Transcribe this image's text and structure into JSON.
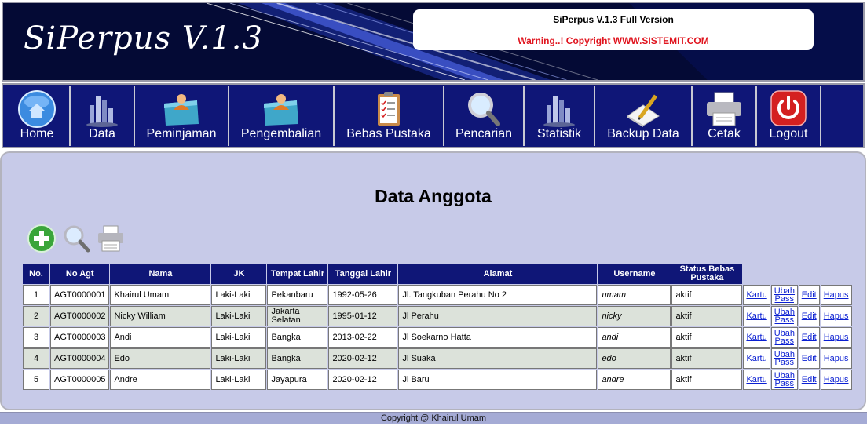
{
  "header": {
    "logo_text": "SiPerpus V.1.3",
    "info_title": "SiPerpus V.1.3 Full Version",
    "info_warning": "Warning..! Copyright WWW.SISTEMIT.COM"
  },
  "nav": {
    "items": [
      {
        "label": "Home",
        "icon": "home-icon"
      },
      {
        "label": "Data",
        "icon": "bar-chart-icon"
      },
      {
        "label": "Peminjaman",
        "icon": "user-folder-icon"
      },
      {
        "label": "Pengembalian",
        "icon": "user-folder-icon"
      },
      {
        "label": "Bebas Pustaka",
        "icon": "clipboard-checklist-icon"
      },
      {
        "label": "Pencarian",
        "icon": "magnifier-icon"
      },
      {
        "label": "Statistik",
        "icon": "bar-chart-icon"
      },
      {
        "label": "Backup Data",
        "icon": "pen-paper-icon"
      },
      {
        "label": "Cetak",
        "icon": "printer-icon"
      },
      {
        "label": "Logout",
        "icon": "power-icon"
      }
    ]
  },
  "main": {
    "title": "Data Anggota",
    "toolbar": [
      "add-icon",
      "search-icon",
      "printer-icon"
    ]
  },
  "table": {
    "headers": {
      "no": "No.",
      "no_agt": "No Agt",
      "nama": "Nama",
      "jk": "JK",
      "tempat_lahir": "Tempat Lahir",
      "tanggal_lahir": "Tanggal Lahir",
      "alamat": "Alamat",
      "username": "Username",
      "status": "Status Bebas Pustaka"
    },
    "actions": {
      "kartu": "Kartu",
      "ubah_pass": "Ubah Pass",
      "edit": "Edit",
      "hapus": "Hapus"
    },
    "rows": [
      {
        "no": "1",
        "no_agt": "AGT0000001",
        "nama": "Khairul Umam",
        "jk": "Laki-Laki",
        "tempat_lahir": "Pekanbaru",
        "tanggal_lahir": "1992-05-26",
        "alamat": "Jl. Tangkuban Perahu No 2",
        "username": "umam",
        "status": "aktif"
      },
      {
        "no": "2",
        "no_agt": "AGT0000002",
        "nama": "Nicky William",
        "jk": "Laki-Laki",
        "tempat_lahir": "Jakarta Selatan",
        "tanggal_lahir": "1995-01-12",
        "alamat": "Jl Perahu",
        "username": "nicky",
        "status": "aktif"
      },
      {
        "no": "3",
        "no_agt": "AGT0000003",
        "nama": "Andi",
        "jk": "Laki-Laki",
        "tempat_lahir": "Bangka",
        "tanggal_lahir": "2013-02-22",
        "alamat": "Jl Soekarno Hatta",
        "username": "andi",
        "status": "aktif"
      },
      {
        "no": "4",
        "no_agt": "AGT0000004",
        "nama": "Edo",
        "jk": "Laki-Laki",
        "tempat_lahir": "Bangka",
        "tanggal_lahir": "2020-02-12",
        "alamat": "Jl Suaka",
        "username": "edo",
        "status": "aktif"
      },
      {
        "no": "5",
        "no_agt": "AGT0000005",
        "nama": "Andre",
        "jk": "Laki-Laki",
        "tempat_lahir": "Jayapura",
        "tanggal_lahir": "2020-02-12",
        "alamat": "Jl Baru",
        "username": "andre",
        "status": "aktif"
      }
    ]
  },
  "footer": {
    "text": "Copyright @ Khairul Umam"
  },
  "colors": {
    "header_bg": "#040a35",
    "nav_bg": "#0f1677",
    "content_bg": "#c7cae8",
    "table_header_bg": "#0f1677",
    "row_alt_bg": "#dce2da",
    "warning_red": "#e0141e",
    "link_blue": "#0a1fd2"
  }
}
